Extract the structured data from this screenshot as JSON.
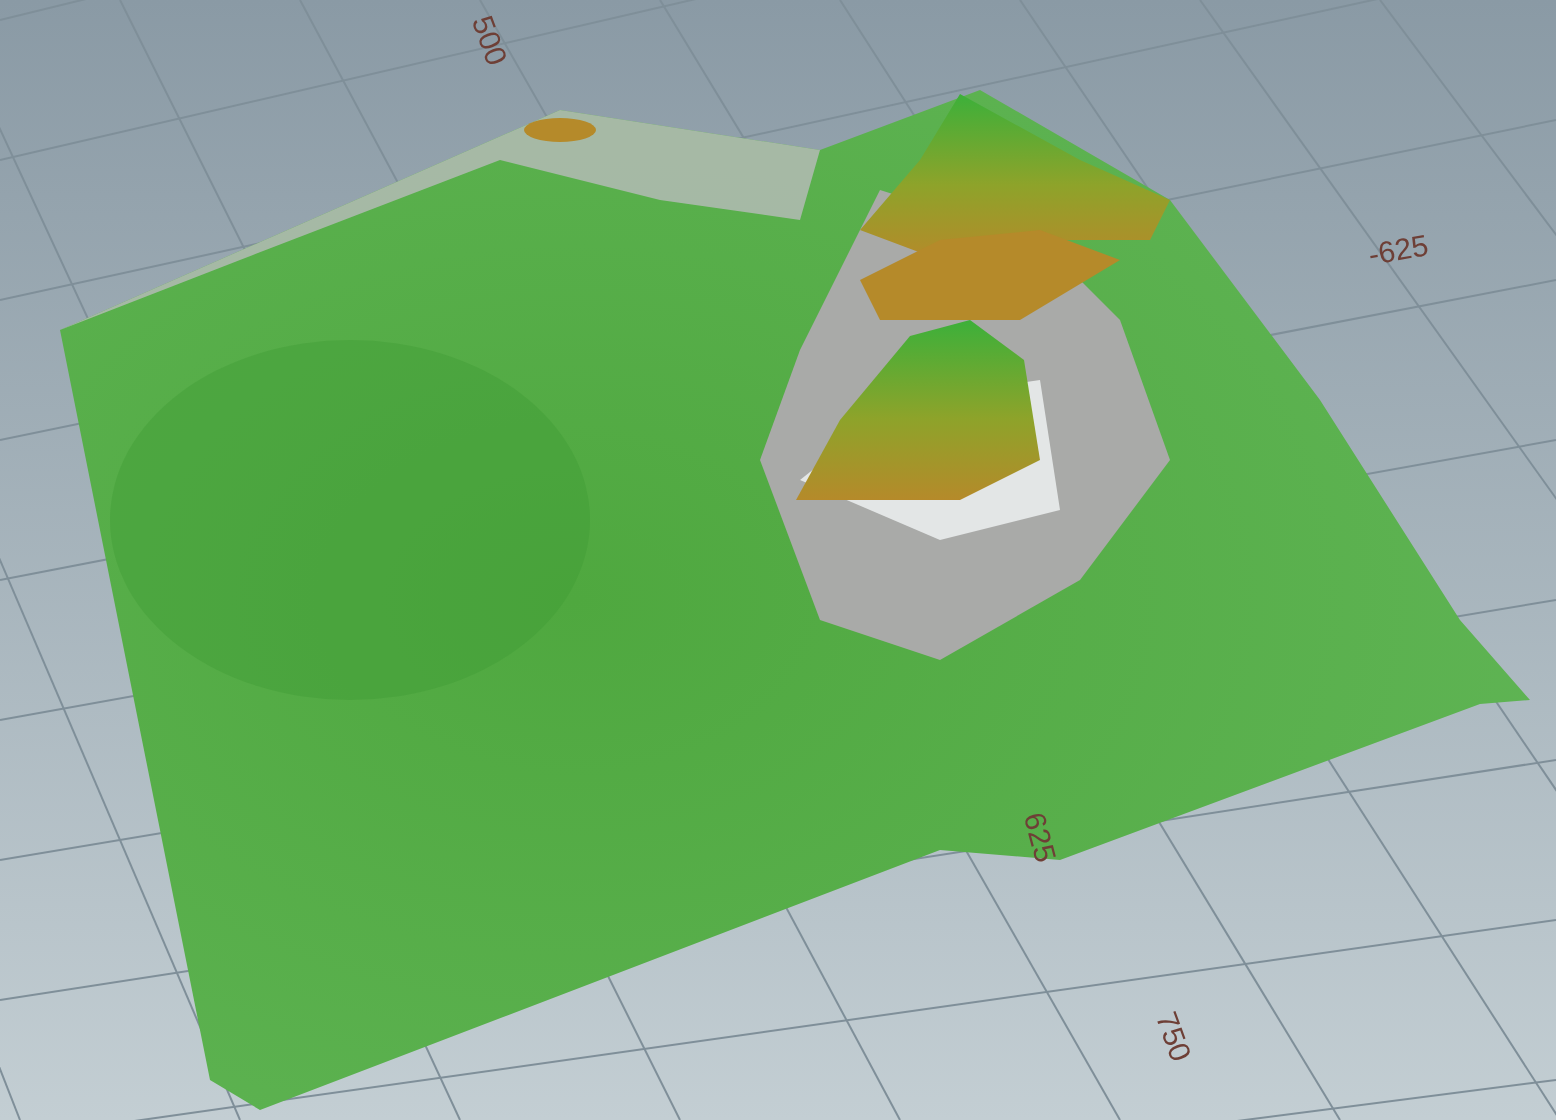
{
  "viewport": {
    "grid_labels": [
      {
        "text": "500"
      },
      {
        "text": "-625"
      },
      {
        "text": "625"
      },
      {
        "text": "750"
      }
    ]
  }
}
